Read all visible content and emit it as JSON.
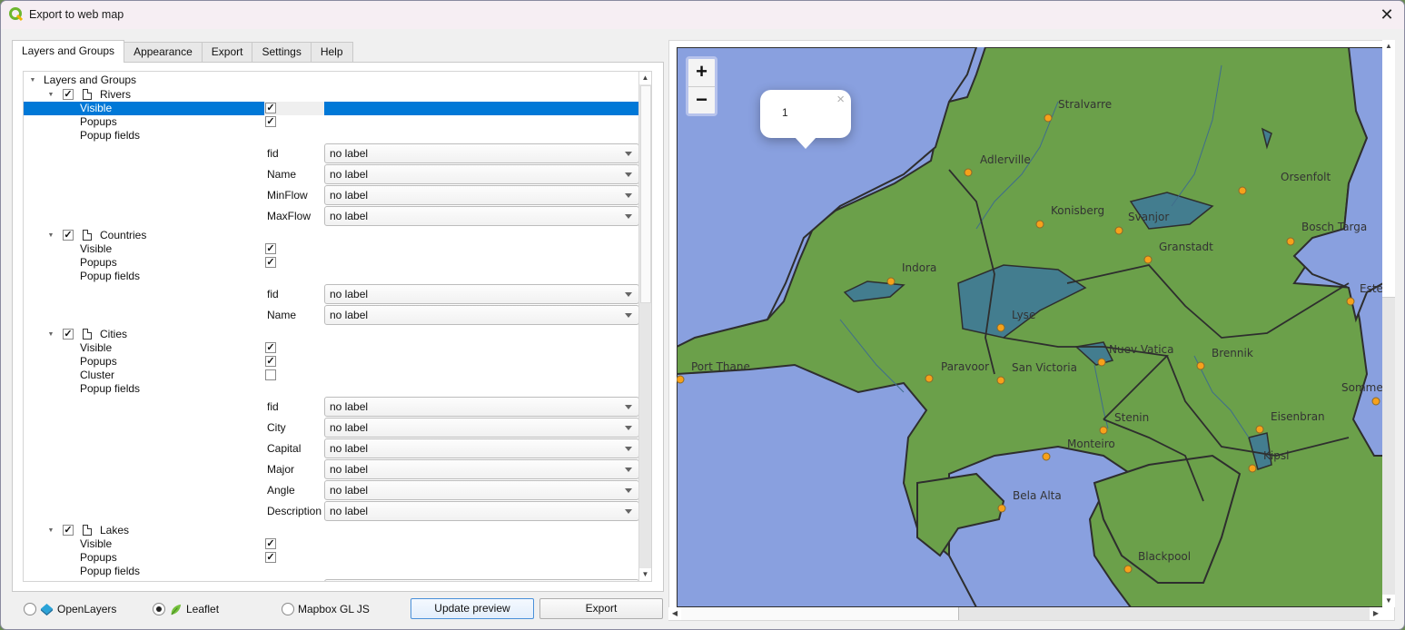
{
  "window": {
    "title": "Export to web map",
    "close_glyph": "✕"
  },
  "tabs": [
    {
      "label": "Layers and Groups",
      "active": true
    },
    {
      "label": "Appearance",
      "active": false
    },
    {
      "label": "Export",
      "active": false
    },
    {
      "label": "Settings",
      "active": false
    },
    {
      "label": "Help",
      "active": false
    }
  ],
  "tree": {
    "root_label": "Layers and Groups",
    "no_label_value": "no label",
    "layers": [
      {
        "name": "Rivers",
        "checked": true,
        "props": [
          {
            "label": "Visible",
            "checked": true,
            "selected": true
          },
          {
            "label": "Popups",
            "checked": true
          },
          {
            "label": "Popup fields"
          }
        ],
        "fields": [
          {
            "name": "fid",
            "value": "no label"
          },
          {
            "name": "Name",
            "value": "no label"
          },
          {
            "name": "MinFlow",
            "value": "no label"
          },
          {
            "name": "MaxFlow",
            "value": "no label"
          }
        ]
      },
      {
        "name": "Countries",
        "checked": true,
        "props": [
          {
            "label": "Visible",
            "checked": true
          },
          {
            "label": "Popups",
            "checked": true
          },
          {
            "label": "Popup fields"
          }
        ],
        "fields": [
          {
            "name": "fid",
            "value": "no label"
          },
          {
            "name": "Name",
            "value": "no label"
          }
        ]
      },
      {
        "name": "Cities",
        "checked": true,
        "props": [
          {
            "label": "Visible",
            "checked": true
          },
          {
            "label": "Popups",
            "checked": true
          },
          {
            "label": "Cluster",
            "checked": false
          },
          {
            "label": "Popup fields"
          }
        ],
        "fields": [
          {
            "name": "fid",
            "value": "no label"
          },
          {
            "name": "City",
            "value": "no label"
          },
          {
            "name": "Capital",
            "value": "no label"
          },
          {
            "name": "Major",
            "value": "no label"
          },
          {
            "name": "Angle",
            "value": "no label"
          },
          {
            "name": "Description",
            "value": "no label"
          }
        ]
      },
      {
        "name": "Lakes",
        "checked": true,
        "props": [
          {
            "label": "Visible",
            "checked": true
          },
          {
            "label": "Popups",
            "checked": true
          },
          {
            "label": "Popup fields"
          }
        ],
        "fields": []
      }
    ]
  },
  "bottom": {
    "renderers": [
      {
        "label": "OpenLayers",
        "selected": false,
        "icon": "openlayers-icon"
      },
      {
        "label": "Leaflet",
        "selected": true,
        "icon": "leaflet-icon"
      },
      {
        "label": "Mapbox GL JS",
        "selected": false,
        "icon": null
      }
    ],
    "update_preview_label": "Update preview",
    "export_label": "Export"
  },
  "map": {
    "zoom_in": "+",
    "zoom_out": "−",
    "popup": {
      "text": "1",
      "close": "×"
    },
    "colors": {
      "water": "#89a0df",
      "land": "#6ba04a",
      "lake": "#437d8f",
      "border": "#2e2e2e",
      "river": "#3f6d8c",
      "city": "#f7a11a"
    },
    "cities": [
      {
        "name": "Stralvarre"
      },
      {
        "name": "Adlerville"
      },
      {
        "name": "Orsenfolt"
      },
      {
        "name": "Konisberg"
      },
      {
        "name": "Svanjor"
      },
      {
        "name": "Bosch Targa"
      },
      {
        "name": "Granstadt"
      },
      {
        "name": "Indora"
      },
      {
        "name": "Este"
      },
      {
        "name": "Lyse"
      },
      {
        "name": "Port Thane"
      },
      {
        "name": "Paravoor"
      },
      {
        "name": "San Victoria"
      },
      {
        "name": "Nuev Vatica"
      },
      {
        "name": "Brennik"
      },
      {
        "name": "Somme"
      },
      {
        "name": "Stenin"
      },
      {
        "name": "Eisenbran"
      },
      {
        "name": "Monteiro"
      },
      {
        "name": "Kipsi"
      },
      {
        "name": "Bela Alta"
      },
      {
        "name": "Blackpool"
      }
    ]
  }
}
